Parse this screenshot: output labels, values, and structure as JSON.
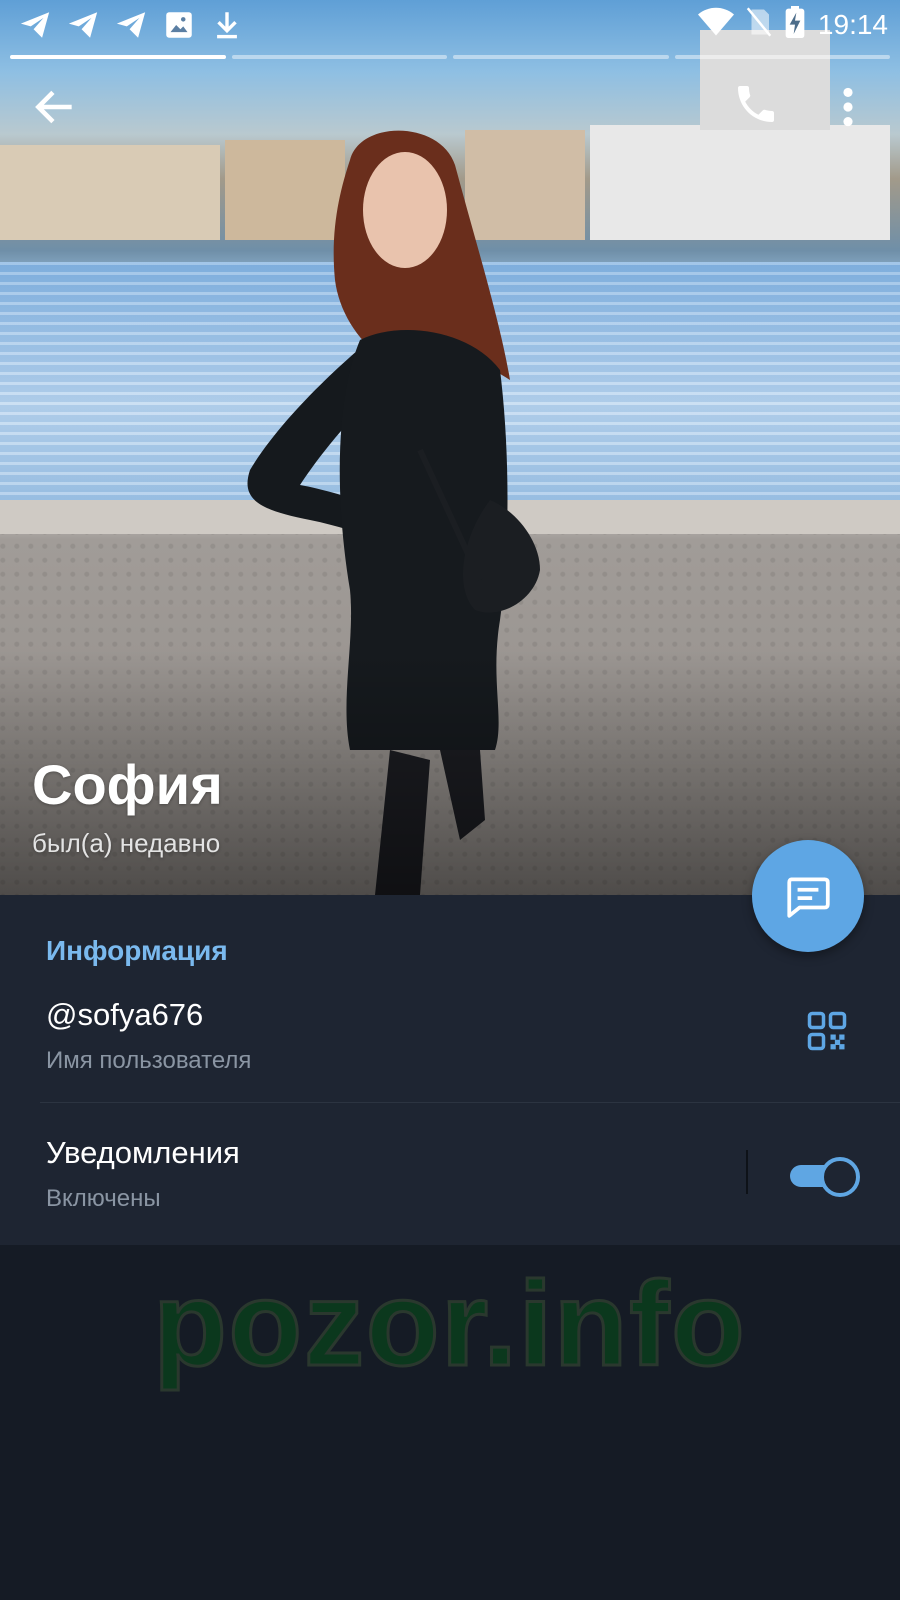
{
  "status_bar": {
    "time": "19:14",
    "left_icons": [
      "telegram-icon",
      "telegram-icon",
      "telegram-icon",
      "image-icon",
      "download-icon"
    ],
    "right_icons": [
      "wifi-icon",
      "no-sim-icon",
      "battery-charging-icon"
    ]
  },
  "stories": {
    "count": 4,
    "active_index": 0
  },
  "toolbar": {
    "back_icon": "arrow-left-icon",
    "call_icon": "phone-icon",
    "menu_icon": "more-vertical-icon"
  },
  "profile": {
    "name": "София",
    "status": "был(а) недавно"
  },
  "fab": {
    "icon": "message-icon",
    "color": "#5ea6e4"
  },
  "info": {
    "section_title": "Информация",
    "username": "@sofya676",
    "username_label": "Имя пользователя",
    "notifications": "Уведомления",
    "notifications_state": "Включены",
    "notifications_enabled": true
  },
  "watermark": "pozor.info",
  "colors": {
    "accent": "#5ea6e4",
    "section_title": "#7ab9ee",
    "panel_bg": "#1e2532",
    "page_bg": "#151b25",
    "secondary_text": "#8a95a3"
  }
}
